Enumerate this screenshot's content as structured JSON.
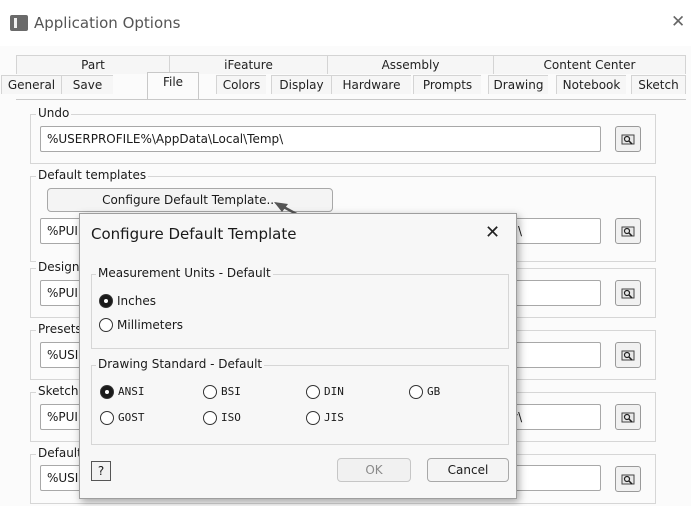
{
  "window": {
    "title": "Application Options"
  },
  "tabs": {
    "row1": [
      "Part",
      "iFeature",
      "Assembly",
      "Content Center"
    ],
    "row2": [
      "General",
      "Save",
      "File",
      "Colors",
      "Display",
      "Hardware",
      "Prompts",
      "Drawing",
      "Notebook",
      "Sketch"
    ],
    "active": "File"
  },
  "undo": {
    "label": "Undo",
    "path": "%USERPROFILE%\\AppData\\Local\\Temp\\"
  },
  "default_templates": {
    "label": "Default templates",
    "configure_button": "Configure Default Template...",
    "path_visible": "%PUI",
    "path_tail": "\\"
  },
  "design": {
    "label": "Design",
    "path_visible": "%PUI"
  },
  "presets": {
    "label": "Presets",
    "path_visible": "%USI"
  },
  "sketch": {
    "label": "Sketch",
    "path_visible": "%PUI",
    "path_tail": "y\\"
  },
  "default_bottom": {
    "label": "Default",
    "path_visible": "%USI"
  },
  "dialog": {
    "title": "Configure Default Template",
    "measurement": {
      "label": "Measurement Units - Default",
      "options": [
        "Inches",
        "Millimeters"
      ],
      "selected": "Inches"
    },
    "standard": {
      "label": "Drawing Standard - Default",
      "options": [
        "ANSI",
        "BSI",
        "DIN",
        "GB",
        "GOST",
        "ISO",
        "JIS"
      ],
      "selected": "ANSI"
    },
    "help": "?",
    "ok": "OK",
    "cancel": "Cancel"
  },
  "icons": {
    "browse": "folder-browse-icon",
    "close": "close-icon",
    "help": "help-icon"
  }
}
